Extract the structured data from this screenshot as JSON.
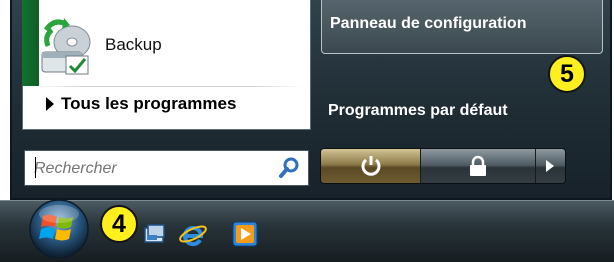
{
  "start_menu": {
    "pinned_item_label": "Backup",
    "all_programs_label": "Tous les programmes",
    "search_placeholder": "Rechercher",
    "control_panel_label": "Panneau de configuration",
    "default_programs_label": "Programmes par défaut"
  },
  "annotations": {
    "badge_4": "4",
    "badge_5": "5"
  },
  "taskbar": {
    "quick_launch_icons": [
      "show-desktop-icon",
      "internet-explorer-icon",
      "media-player-icon"
    ]
  },
  "colors": {
    "menu_background": "#1f2c34",
    "badge_yellow": "#ffef1f",
    "power_button": "#8e7a49"
  }
}
